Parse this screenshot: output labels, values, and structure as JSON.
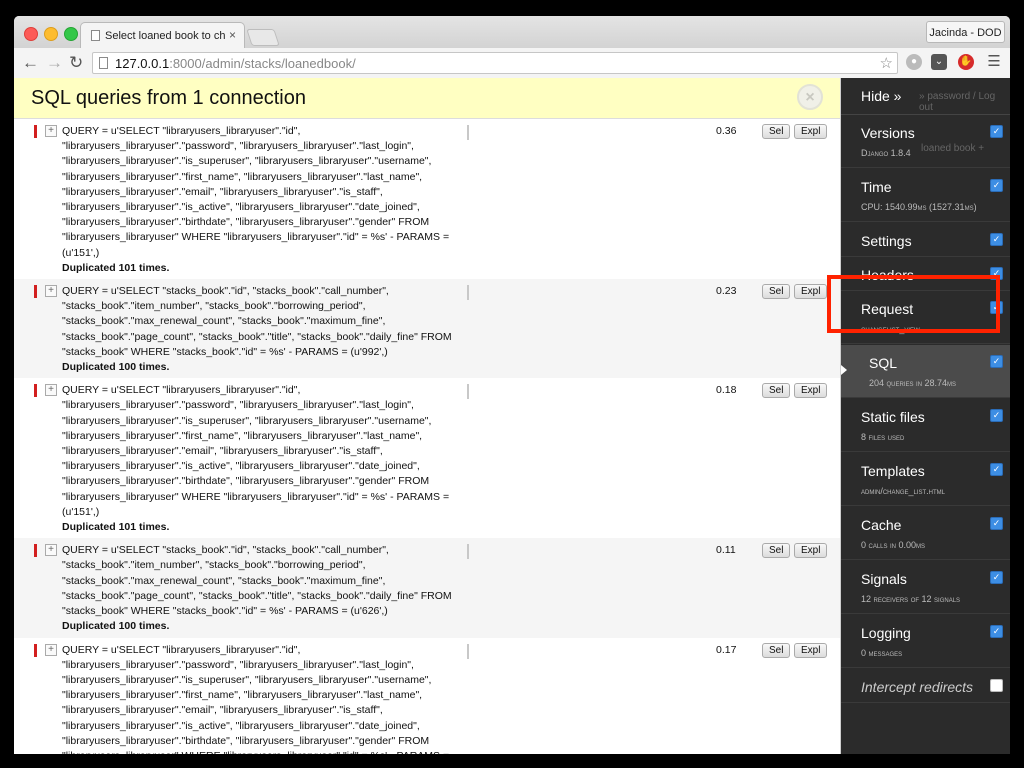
{
  "browser": {
    "tab_title": "Select loaned book to change",
    "tab_close": "×",
    "profile": "Jacinda - DOD",
    "url_host": "127.0.0.1",
    "url_rest": ":8000/admin/stacks/loanedbook/"
  },
  "panel": {
    "title": "SQL queries from 1 connection",
    "close": "×"
  },
  "queries": [
    {
      "text": "QUERY = u'SELECT \"libraryusers_libraryuser\".\"id\", \"libraryusers_libraryuser\".\"password\", \"libraryusers_libraryuser\".\"last_login\", \"libraryusers_libraryuser\".\"is_superuser\", \"libraryusers_libraryuser\".\"username\", \"libraryusers_libraryuser\".\"first_name\", \"libraryusers_libraryuser\".\"last_name\", \"libraryusers_libraryuser\".\"email\", \"libraryusers_libraryuser\".\"is_staff\", \"libraryusers_libraryuser\".\"is_active\", \"libraryusers_libraryuser\".\"date_joined\", \"libraryusers_libraryuser\".\"birthdate\", \"libraryusers_libraryuser\".\"gender\" FROM \"libraryusers_libraryuser\" WHERE \"libraryusers_libraryuser\".\"id\" = %s' - PARAMS = (u'151',)",
      "dup": "Duplicated 101 times.",
      "time": "0.36"
    },
    {
      "text": "QUERY = u'SELECT \"stacks_book\".\"id\", \"stacks_book\".\"call_number\", \"stacks_book\".\"item_number\", \"stacks_book\".\"borrowing_period\", \"stacks_book\".\"max_renewal_count\", \"stacks_book\".\"maximum_fine\", \"stacks_book\".\"page_count\", \"stacks_book\".\"title\", \"stacks_book\".\"daily_fine\" FROM \"stacks_book\" WHERE \"stacks_book\".\"id\" = %s' - PARAMS = (u'992',)",
      "dup": "Duplicated 100 times.",
      "time": "0.23"
    },
    {
      "text": "QUERY = u'SELECT \"libraryusers_libraryuser\".\"id\", \"libraryusers_libraryuser\".\"password\", \"libraryusers_libraryuser\".\"last_login\", \"libraryusers_libraryuser\".\"is_superuser\", \"libraryusers_libraryuser\".\"username\", \"libraryusers_libraryuser\".\"first_name\", \"libraryusers_libraryuser\".\"last_name\", \"libraryusers_libraryuser\".\"email\", \"libraryusers_libraryuser\".\"is_staff\", \"libraryusers_libraryuser\".\"is_active\", \"libraryusers_libraryuser\".\"date_joined\", \"libraryusers_libraryuser\".\"birthdate\", \"libraryusers_libraryuser\".\"gender\" FROM \"libraryusers_libraryuser\" WHERE \"libraryusers_libraryuser\".\"id\" = %s' - PARAMS = (u'151',)",
      "dup": "Duplicated 101 times.",
      "time": "0.18"
    },
    {
      "text": "QUERY = u'SELECT \"stacks_book\".\"id\", \"stacks_book\".\"call_number\", \"stacks_book\".\"item_number\", \"stacks_book\".\"borrowing_period\", \"stacks_book\".\"max_renewal_count\", \"stacks_book\".\"maximum_fine\", \"stacks_book\".\"page_count\", \"stacks_book\".\"title\", \"stacks_book\".\"daily_fine\" FROM \"stacks_book\" WHERE \"stacks_book\".\"id\" = %s' - PARAMS = (u'626',)",
      "dup": "Duplicated 100 times.",
      "time": "0.11"
    },
    {
      "text": "QUERY = u'SELECT \"libraryusers_libraryuser\".\"id\", \"libraryusers_libraryuser\".\"password\", \"libraryusers_libraryuser\".\"last_login\", \"libraryusers_libraryuser\".\"is_superuser\", \"libraryusers_libraryuser\".\"username\", \"libraryusers_libraryuser\".\"first_name\", \"libraryusers_libraryuser\".\"last_name\", \"libraryusers_libraryuser\".\"email\", \"libraryusers_libraryuser\".\"is_staff\", \"libraryusers_libraryuser\".\"is_active\", \"libraryusers_libraryuser\".\"date_joined\", \"libraryusers_libraryuser\".\"birthdate\", \"libraryusers_libraryuser\".\"gender\" FROM \"libraryusers_libraryuser\" WHERE \"libraryusers_libraryuser\".\"id\" = %s' - PARAMS =",
      "dup": "",
      "time": "0.17"
    }
  ],
  "buttons": {
    "sel": "Sel",
    "expl": "Expl"
  },
  "djdt": {
    "hide": "Hide »",
    "background_text": "» password / Log out",
    "background_button": "loaned book +",
    "items": [
      {
        "title": "Versions",
        "sub": "Django 1.8.4",
        "checked": true
      },
      {
        "title": "Time",
        "sub": "CPU: 1540.99ms (1527.31ms)",
        "checked": true
      },
      {
        "title": "Settings",
        "sub": "",
        "checked": true
      },
      {
        "title": "Headers",
        "sub": "",
        "checked": true
      },
      {
        "title": "Request",
        "sub": "changelist_view",
        "checked": true
      },
      {
        "title": "SQL",
        "sub": "204 queries in 28.74ms",
        "checked": true
      },
      {
        "title": "Static files",
        "sub": "8 files used",
        "checked": true
      },
      {
        "title": "Templates",
        "sub": "admin/change_list.html",
        "checked": true
      },
      {
        "title": "Cache",
        "sub": "0 calls in 0.00ms",
        "checked": true
      },
      {
        "title": "Signals",
        "sub": "12 receivers of 12 signals",
        "checked": true
      },
      {
        "title": "Logging",
        "sub": "0 messages",
        "checked": true
      },
      {
        "title": "Intercept redirects",
        "sub": "",
        "checked": false
      }
    ]
  },
  "colors": {
    "highlight": "#ff2200",
    "sql_marker": "#d21f1f",
    "panel_header": "#ffffc2",
    "toolbar_bg": "#2b2b2b"
  }
}
